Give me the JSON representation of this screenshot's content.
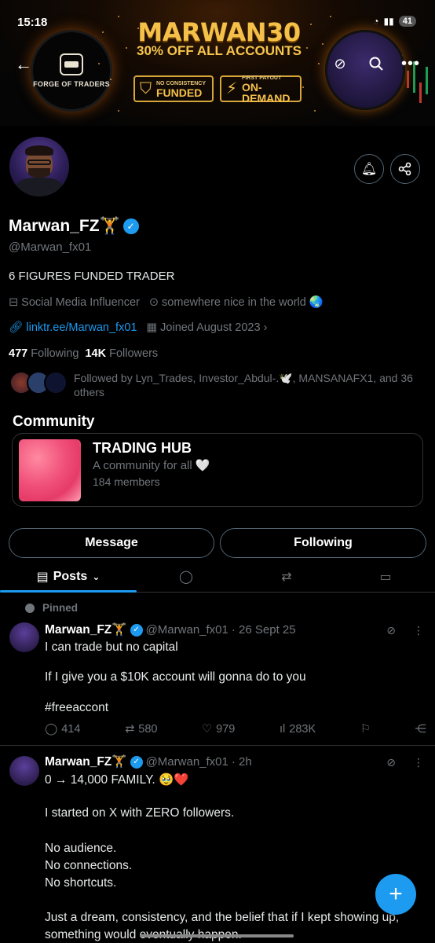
{
  "status_bar": {
    "time": "15:18",
    "battery": "41"
  },
  "banner": {
    "logo_text": "FORGE OF TRADERS",
    "promo_title": "MARWAN30",
    "promo_subtitle": "30% OFF ALL ACCOUNTS",
    "badge1_small": "NO CONSISTENCY",
    "badge1_big": "FUNDED",
    "badge2_small": "FIRST PAYOUT",
    "badge2_big": "ON-DEMAND"
  },
  "profile": {
    "display_name": "Marwan_FZ🏋️",
    "handle": "@Marwan_fx01",
    "bio": "6 FIGURES FUNDED TRADER",
    "category": "Social Media Influencer",
    "location": "somewhere nice in the world 🌏",
    "link": "linktr.ee/Marwan_fx01",
    "joined": "Joined August 2023",
    "following_count": "477",
    "following_label": "Following",
    "followers_count": "14K",
    "followers_label": "Followers",
    "followed_by": "Followed by Lyn_Trades, Investor_Abdul-.🕊️, MANSANAFX1, and 36 others"
  },
  "community": {
    "section_title": "Community",
    "name": "TRADING HUB",
    "description": "A community for all 🤍",
    "members": "184 members"
  },
  "buttons": {
    "message": "Message",
    "following": "Following"
  },
  "tabs": {
    "posts": "Posts"
  },
  "pinned_label": "Pinned",
  "posts": [
    {
      "author": "Marwan_FZ🏋️",
      "handle": "@Marwan_fx01",
      "time": "· 26 Sept 25",
      "line1": "I can trade but no capital",
      "line2": "If I give you a $10K account will gonna do to you",
      "hashtag": "#freeaccont",
      "replies": "414",
      "reposts": "580",
      "likes": "979",
      "views": "283K"
    },
    {
      "author": "Marwan_FZ🏋️",
      "handle": "@Marwan_fx01",
      "time": "· 2h",
      "line1": "0 → 14,000 FAMILY. 🥹❤️",
      "line2": "I started on X with ZERO followers.",
      "line3": "No audience.",
      "line4": "No connections.",
      "line5": "No shortcuts.",
      "line6": "Just a dream, consistency, and the belief that if I kept showing up, something would eventually happen."
    }
  ],
  "icons": [
    "back-arrow-icon",
    "no-sync-icon",
    "search-icon",
    "more-icon",
    "add-notification-icon",
    "share-icon",
    "verified-icon",
    "briefcase-icon",
    "location-icon",
    "link-icon",
    "calendar-icon",
    "chevron-right-icon",
    "reply-icon",
    "repost-icon",
    "like-icon",
    "views-icon",
    "bookmark-icon",
    "plus-icon"
  ],
  "colors": {
    "accent": "#1d9bf0",
    "background": "#000000",
    "muted": "#71767b",
    "promo_gold": "#f5c04a"
  }
}
